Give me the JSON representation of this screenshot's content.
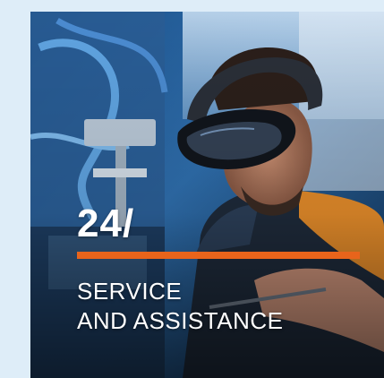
{
  "promo": {
    "title": "24/",
    "caption_line1": "SERVICE",
    "caption_line2": "AND ASSISTANCE",
    "image_alt": "Technician wearing mixed reality headset working on machinery"
  },
  "colors": {
    "page_bg": "#deedf8",
    "accent": "#e8641b",
    "text": "#ffffff"
  }
}
